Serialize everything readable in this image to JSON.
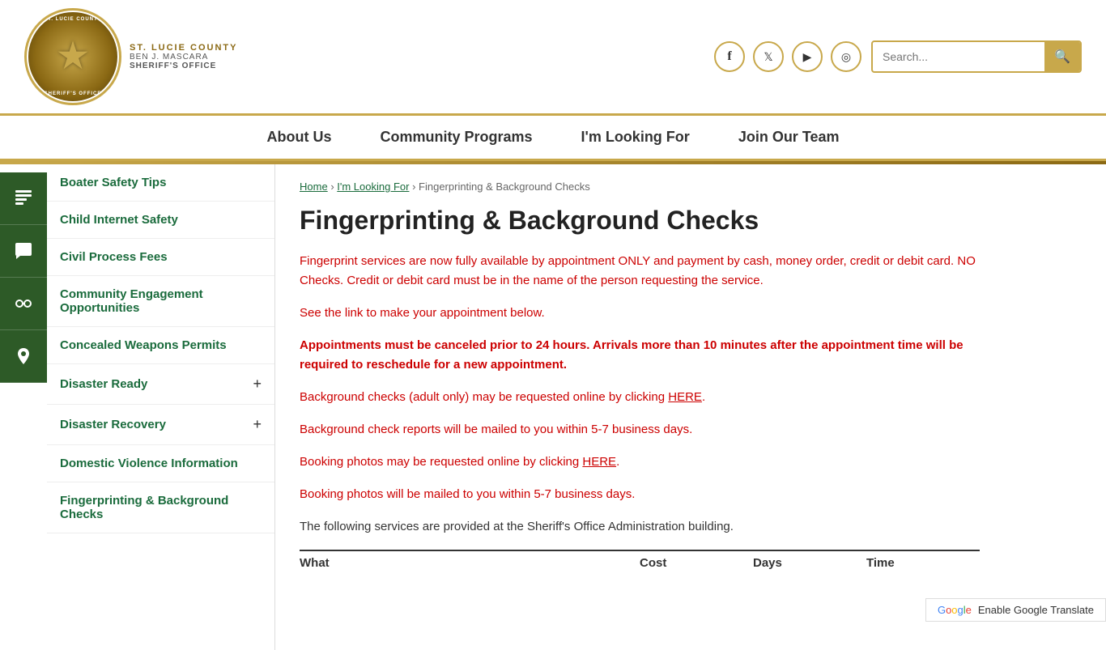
{
  "header": {
    "logo_text_top": "ST. LUCIE COUNTY",
    "logo_text_mid": "BEN J. MASCARA",
    "logo_text_bottom": "SHERIFF'S OFFICE",
    "search_placeholder": "Search...",
    "social": [
      {
        "name": "facebook",
        "icon": "f"
      },
      {
        "name": "twitter",
        "icon": "t"
      },
      {
        "name": "youtube",
        "icon": "▶"
      },
      {
        "name": "instagram",
        "icon": "◉"
      }
    ]
  },
  "nav": {
    "items": [
      {
        "label": "About Us",
        "id": "about-us"
      },
      {
        "label": "Community Programs",
        "id": "community-programs"
      },
      {
        "label": "I'm Looking For",
        "id": "im-looking-for"
      },
      {
        "label": "Join Our Team",
        "id": "join-our-team"
      }
    ]
  },
  "sidebar": {
    "icons": [
      {
        "name": "news-icon",
        "symbol": "📋"
      },
      {
        "name": "chat-icon",
        "symbol": "💬"
      },
      {
        "name": "handcuffs-icon",
        "symbol": "🔗"
      },
      {
        "name": "location-icon",
        "symbol": "📍"
      }
    ],
    "items": [
      {
        "label": "Boater Safety Tips",
        "id": "boater-safety",
        "has_expand": false
      },
      {
        "label": "Child Internet Safety",
        "id": "child-internet",
        "has_expand": false
      },
      {
        "label": "Civil Process Fees",
        "id": "civil-process",
        "has_expand": false
      },
      {
        "label": "Community Engagement Opportunities",
        "id": "community-engagement",
        "has_expand": false
      },
      {
        "label": "Concealed Weapons Permits",
        "id": "concealed-weapons",
        "has_expand": false
      },
      {
        "label": "Disaster Ready",
        "id": "disaster-ready",
        "has_expand": true
      },
      {
        "label": "Disaster Recovery",
        "id": "disaster-recovery",
        "has_expand": true
      },
      {
        "label": "Domestic Violence Information",
        "id": "domestic-violence",
        "has_expand": false
      },
      {
        "label": "Fingerprinting & Background Checks",
        "id": "fingerprinting",
        "has_expand": false
      }
    ]
  },
  "breadcrumb": {
    "home": "Home",
    "looking_for": "I'm Looking For",
    "current": "Fingerprinting & Background Checks"
  },
  "content": {
    "title": "Fingerprinting & Background Checks",
    "para1": "Fingerprint services are now fully available by appointment ONLY and payment by cash, money order, credit or debit card.  NO Checks. Credit or debit card must be in the name of the person requesting the service.",
    "para2": "See the link to make your appointment below.",
    "para3": "Appointments must be canceled prior to 24 hours. Arrivals more than 10 minutes after the appointment time will be required to reschedule for a new appointment.",
    "para4_pre": "Background checks (adult only) may be requested online by clicking ",
    "para4_link": "HERE",
    "para4_post": ".",
    "para4b": "Background check reports will be mailed to you within 5-7 business days.",
    "para5_pre": "Booking photos may be requested online by clicking ",
    "para5_link": "HERE",
    "para5_post": ".",
    "para5b": "Booking photos will be mailed to you within 5-7 business days.",
    "para6": "The following services are provided at the Sheriff's Office Administration building.",
    "table_headers": {
      "what": "What",
      "cost": "Cost",
      "days": "Days",
      "time": "Time"
    }
  },
  "translate": {
    "label": "Enable Google Translate"
  }
}
